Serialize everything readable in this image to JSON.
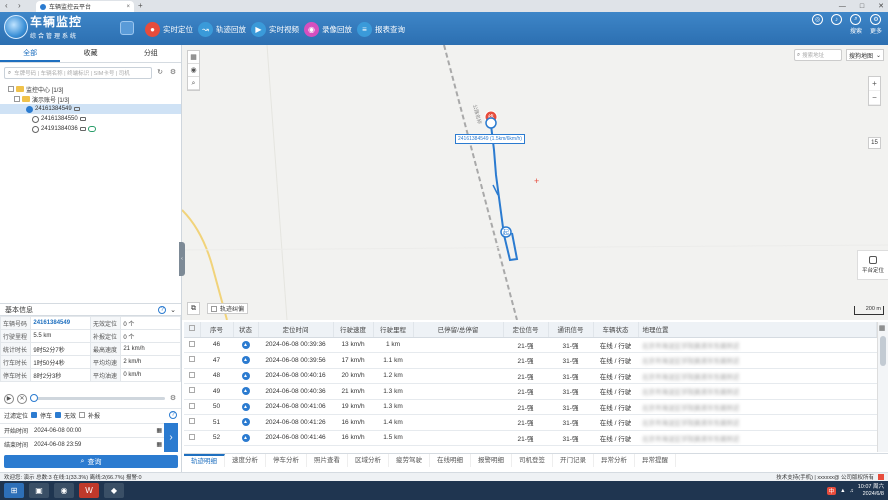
{
  "browser": {
    "tab_title": "车辆监控云平台",
    "new_tab": "+",
    "close": "×",
    "win_minimize": "—",
    "win_maximize": "□",
    "win_close": "✕"
  },
  "header": {
    "brand": "车辆监控",
    "brand_sub": "综合管理系统",
    "nav": [
      {
        "label": "实时定位",
        "icon": "location-icon",
        "color": "#e74c3c"
      },
      {
        "label": "轨迹回放",
        "icon": "track-icon",
        "color": "#3a9ad9"
      },
      {
        "label": "实时视频",
        "icon": "video-icon",
        "color": "#3a9ad9"
      },
      {
        "label": "录像回放",
        "icon": "record-icon",
        "color": "#d64fbf"
      },
      {
        "label": "报表查询",
        "icon": "report-icon",
        "color": "#3a9ad9"
      }
    ],
    "right": [
      {
        "label": "",
        "icon": "globe-icon"
      },
      {
        "label": "",
        "icon": "bell-icon",
        "badge": "1"
      },
      {
        "label": "搜索",
        "icon": "search-icon"
      },
      {
        "label": "更多",
        "icon": "more-icon"
      }
    ]
  },
  "left": {
    "tabs": [
      "全部",
      "收藏",
      "分组"
    ],
    "search_placeholder": "车牌号码 | 车辆名称 | 终端标识 | SIM卡号 | 司机",
    "tree": [
      {
        "label": "监控中心 [1/3]",
        "level": 0,
        "type": "folder"
      },
      {
        "label": "演示账号 [1/3]",
        "level": 1,
        "type": "folder"
      },
      {
        "label": "24161384549",
        "level": 2,
        "type": "vehicle",
        "selected": true
      },
      {
        "label": "24161384550",
        "level": 2,
        "type": "vehicle"
      },
      {
        "label": "24191384036",
        "level": 2,
        "type": "vehicle"
      }
    ],
    "info_title": "基本信息",
    "info": [
      [
        "车辆号码",
        "24161384549",
        "无效定位",
        "0 个"
      ],
      [
        "行驶里程",
        "5.5 km",
        "补报定位",
        "0 个"
      ],
      [
        "统计时长",
        "9时52分7秒",
        "最高速度",
        "21 km/h"
      ],
      [
        "行车时长",
        "1时50分4秒",
        "平均均速",
        "2 km/h"
      ],
      [
        "停车时长",
        "8时2分3秒",
        "平均油速",
        "0 km/h"
      ]
    ],
    "filter_label": "过滤定位",
    "filter_opts": [
      {
        "label": "停车",
        "checked": true
      },
      {
        "label": "无效",
        "checked": true
      },
      {
        "label": "补报",
        "checked": false
      }
    ],
    "start_label": "开始时间",
    "start_value": "2024-06-08  00:00",
    "end_label": "结束时间",
    "end_value": "2024-06-08  23:59",
    "query_btn": "查询"
  },
  "map": {
    "addr_placeholder": "搜索地址",
    "map_type": "搜狗地图",
    "zoom_in": "+",
    "zoom_out": "−",
    "zoom_level": "15",
    "vehicle_label": "24161384549 (1.5km/6km/h)",
    "road_label": "公路名称",
    "track_checkbox": "轨迹纠偏",
    "scale": "200 m",
    "side_tab": "平台定位"
  },
  "table": {
    "headers": [
      "",
      "序号",
      "状态",
      "定位时间",
      "行驶速度",
      "行驶里程",
      "已停留/总停留",
      "定位信号",
      "通讯信号",
      "车辆状态",
      "地理位置"
    ],
    "rows": [
      [
        "46",
        "2024-06-08 00:39:36",
        "13 km/h",
        "1 km",
        "",
        "21-强",
        "31-强",
        "在线 / 行驶",
        "北京市海淀区学院路清华东路附近"
      ],
      [
        "47",
        "2024-06-08 00:39:56",
        "17 km/h",
        "1.1 km",
        "",
        "21-强",
        "31-强",
        "在线 / 行驶",
        "北京市海淀区学院路清华东路附近"
      ],
      [
        "48",
        "2024-06-08 00:40:16",
        "20 km/h",
        "1.2 km",
        "",
        "21-强",
        "31-强",
        "在线 / 行驶",
        "北京市海淀区学院路清华东路附近"
      ],
      [
        "49",
        "2024-06-08 00:40:36",
        "21 km/h",
        "1.3 km",
        "",
        "21-强",
        "31-强",
        "在线 / 行驶",
        "北京市海淀区学院路清华东路附近"
      ],
      [
        "50",
        "2024-06-08 00:41:06",
        "19 km/h",
        "1.3 km",
        "",
        "21-强",
        "31-强",
        "在线 / 行驶",
        "北京市海淀区学院路清华东路附近"
      ],
      [
        "51",
        "2024-06-08 00:41:26",
        "16 km/h",
        "1.4 km",
        "",
        "21-强",
        "31-强",
        "在线 / 行驶",
        "北京市海淀区学院路清华东路附近"
      ],
      [
        "52",
        "2024-06-08 00:41:46",
        "16 km/h",
        "1.5 km",
        "",
        "21-强",
        "31-强",
        "在线 / 行驶",
        "北京市海淀区学院路清华东路附近"
      ]
    ]
  },
  "bottom_tabs": [
    "轨迹明细",
    "速度分析",
    "停车分析",
    "照片查看",
    "区域分析",
    "疲劳驾驶",
    "在线明细",
    "报警明细",
    "司机登签",
    "开门记录",
    "异常分析",
    "异常提醒"
  ],
  "status": {
    "left": "欢迎您: 演示  总数:3  在线:1(33.3%)  离线:2(66.7%)  报警:0",
    "right": "技术支持(手机) | xxxxxx@ 公司版权所有"
  },
  "taskbar": {
    "time": "10:07 周六",
    "date": "2024/6/8",
    "ime": "中"
  },
  "colors": {
    "header": "#2c6fb1",
    "accent": "#2b7bd0",
    "track": "#2b7bd0"
  }
}
